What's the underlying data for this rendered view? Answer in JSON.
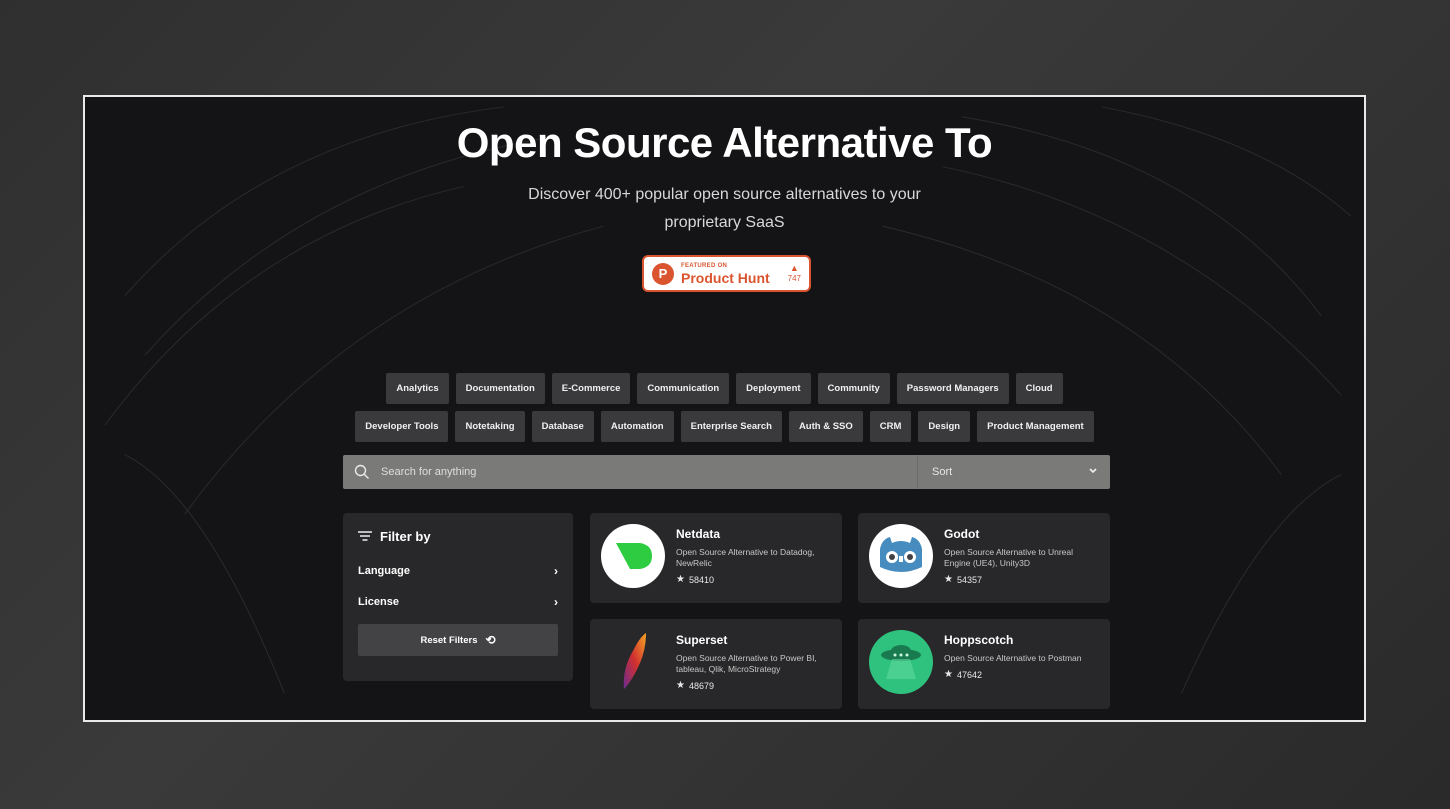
{
  "hero": {
    "title": "Open Source Alternative To",
    "subtitle": "Discover 400+ popular open source alternatives to your proprietary SaaS"
  },
  "producthunt": {
    "featured": "FEATURED ON",
    "name": "Product Hunt",
    "votes": "747"
  },
  "tags": {
    "row1": [
      "Analytics",
      "Documentation",
      "E-Commerce",
      "Communication",
      "Deployment",
      "Community",
      "Password Managers",
      "Cloud"
    ],
    "row2": [
      "Developer Tools",
      "Notetaking",
      "Database",
      "Automation",
      "Enterprise Search",
      "Auth & SSO",
      "CRM",
      "Design",
      "Product Management"
    ]
  },
  "search": {
    "placeholder": "Search for anything",
    "sort_label": "Sort"
  },
  "filter": {
    "title": "Filter by",
    "language": "Language",
    "license": "License",
    "reset": "Reset Filters"
  },
  "cards": [
    {
      "name": "Netdata",
      "desc": "Open Source Alternative to Datadog, NewRelic",
      "stars": "58410",
      "icon": "netdata-logo-icon"
    },
    {
      "name": "Godot",
      "desc": "Open Source Alternative to Unreal Engine (UE4), Unity3D",
      "stars": "54357",
      "icon": "godot-logo-icon"
    },
    {
      "name": "Superset",
      "desc": "Open Source Alternative to Power BI, tableau, Qlik, MicroStrategy",
      "stars": "48679",
      "icon": "superset-logo-icon"
    },
    {
      "name": "Hoppscotch",
      "desc": "Open Source Alternative to Postman",
      "stars": "47642",
      "icon": "hoppscotch-logo-icon"
    }
  ],
  "colors": {
    "accent_producthunt": "#da552f",
    "netdata_green": "#2ecc40",
    "godot_blue": "#478cbf",
    "hoppscotch_green": "#2ec27e"
  }
}
